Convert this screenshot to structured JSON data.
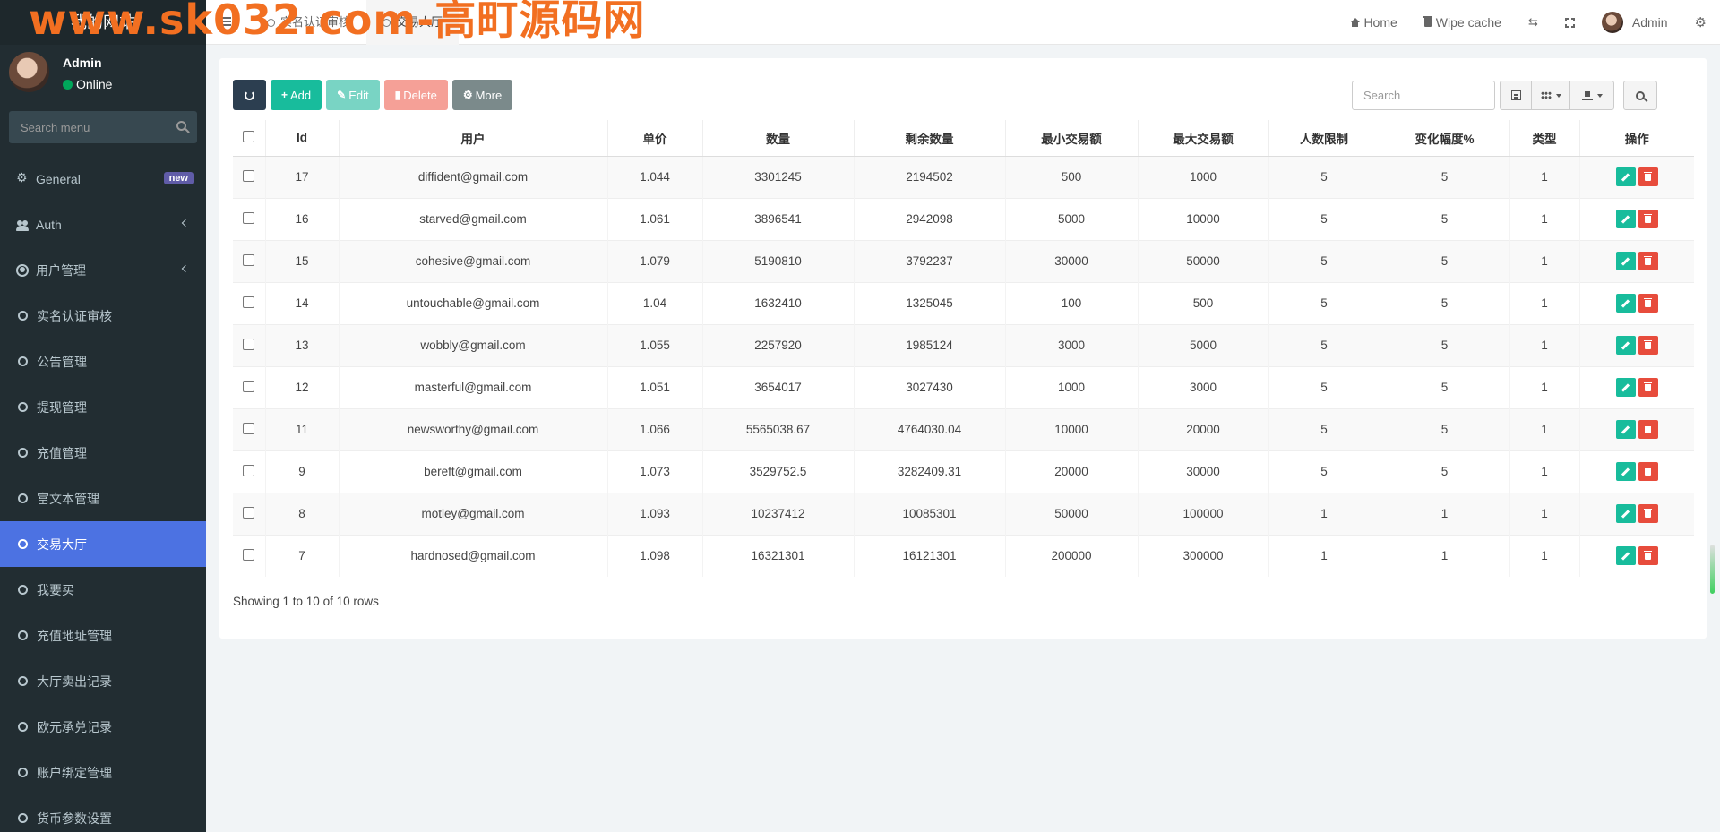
{
  "sidebar": {
    "logo": "我的网站",
    "user": {
      "name": "Admin",
      "status": "Online"
    },
    "search_placeholder": "Search menu",
    "items": [
      {
        "label": "General",
        "badge": "new"
      },
      {
        "label": "Auth"
      },
      {
        "label": "用户管理"
      },
      {
        "label": "实名认证审核"
      },
      {
        "label": "公告管理"
      },
      {
        "label": "提现管理"
      },
      {
        "label": "充值管理"
      },
      {
        "label": "富文本管理"
      },
      {
        "label": "交易大厅",
        "active": true
      },
      {
        "label": "我要买"
      },
      {
        "label": "充值地址管理"
      },
      {
        "label": "大厅卖出记录"
      },
      {
        "label": "欧元承兑记录"
      },
      {
        "label": "账户绑定管理"
      },
      {
        "label": "货币参数设置"
      }
    ]
  },
  "header": {
    "tabs": [
      {
        "label": "实名认证审核"
      },
      {
        "label": "交易大厅"
      }
    ],
    "nav": {
      "home": "Home",
      "wipe_cache": "Wipe cache",
      "user": "Admin"
    }
  },
  "watermark": "www.sk032.com-高町源码网",
  "toolbar": {
    "add": "Add",
    "edit": "Edit",
    "delete": "Delete",
    "more": "More",
    "search_placeholder": "Search"
  },
  "table": {
    "columns": [
      "Id",
      "用户",
      "单价",
      "数量",
      "剩余数量",
      "最小交易额",
      "最大交易额",
      "人数限制",
      "变化幅度%",
      "类型",
      "操作"
    ],
    "rows": [
      {
        "id": "17",
        "user": "diffident@gmail.com",
        "price": "1.044",
        "qty": "3301245",
        "remain": "2194502",
        "min": "500",
        "max": "1000",
        "limit": "5",
        "change": "5",
        "type": "1"
      },
      {
        "id": "16",
        "user": "starved@gmail.com",
        "price": "1.061",
        "qty": "3896541",
        "remain": "2942098",
        "min": "5000",
        "max": "10000",
        "limit": "5",
        "change": "5",
        "type": "1"
      },
      {
        "id": "15",
        "user": "cohesive@gmail.com",
        "price": "1.079",
        "qty": "5190810",
        "remain": "3792237",
        "min": "30000",
        "max": "50000",
        "limit": "5",
        "change": "5",
        "type": "1"
      },
      {
        "id": "14",
        "user": "untouchable@gmail.com",
        "price": "1.04",
        "qty": "1632410",
        "remain": "1325045",
        "min": "100",
        "max": "500",
        "limit": "5",
        "change": "5",
        "type": "1"
      },
      {
        "id": "13",
        "user": "wobbly@gmail.com",
        "price": "1.055",
        "qty": "2257920",
        "remain": "1985124",
        "min": "3000",
        "max": "5000",
        "limit": "5",
        "change": "5",
        "type": "1"
      },
      {
        "id": "12",
        "user": "masterful@gmail.com",
        "price": "1.051",
        "qty": "3654017",
        "remain": "3027430",
        "min": "1000",
        "max": "3000",
        "limit": "5",
        "change": "5",
        "type": "1"
      },
      {
        "id": "11",
        "user": "newsworthy@gmail.com",
        "price": "1.066",
        "qty": "5565038.67",
        "remain": "4764030.04",
        "min": "10000",
        "max": "20000",
        "limit": "5",
        "change": "5",
        "type": "1"
      },
      {
        "id": "9",
        "user": "bereft@gmail.com",
        "price": "1.073",
        "qty": "3529752.5",
        "remain": "3282409.31",
        "min": "20000",
        "max": "30000",
        "limit": "5",
        "change": "5",
        "type": "1"
      },
      {
        "id": "8",
        "user": "motley@gmail.com",
        "price": "1.093",
        "qty": "10237412",
        "remain": "10085301",
        "min": "50000",
        "max": "100000",
        "limit": "1",
        "change": "1",
        "type": "1"
      },
      {
        "id": "7",
        "user": "hardnosed@gmail.com",
        "price": "1.098",
        "qty": "16321301",
        "remain": "16121301",
        "min": "200000",
        "max": "300000",
        "limit": "1",
        "change": "1",
        "type": "1"
      }
    ]
  },
  "pagination": {
    "summary": "Showing 1 to 10 of 10 rows"
  }
}
